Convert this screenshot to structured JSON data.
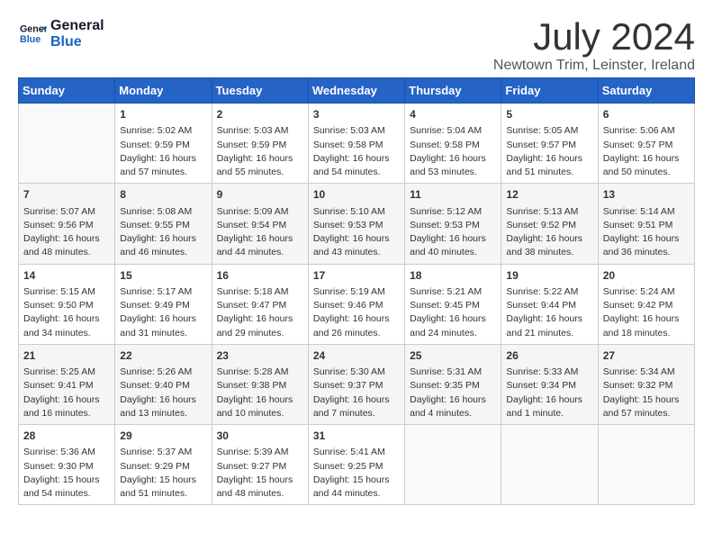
{
  "header": {
    "logo_line1": "General",
    "logo_line2": "Blue",
    "month_year": "July 2024",
    "location": "Newtown Trim, Leinster, Ireland"
  },
  "weekdays": [
    "Sunday",
    "Monday",
    "Tuesday",
    "Wednesday",
    "Thursday",
    "Friday",
    "Saturday"
  ],
  "weeks": [
    [
      {
        "day": "",
        "content": ""
      },
      {
        "day": "1",
        "content": "Sunrise: 5:02 AM\nSunset: 9:59 PM\nDaylight: 16 hours\nand 57 minutes."
      },
      {
        "day": "2",
        "content": "Sunrise: 5:03 AM\nSunset: 9:59 PM\nDaylight: 16 hours\nand 55 minutes."
      },
      {
        "day": "3",
        "content": "Sunrise: 5:03 AM\nSunset: 9:58 PM\nDaylight: 16 hours\nand 54 minutes."
      },
      {
        "day": "4",
        "content": "Sunrise: 5:04 AM\nSunset: 9:58 PM\nDaylight: 16 hours\nand 53 minutes."
      },
      {
        "day": "5",
        "content": "Sunrise: 5:05 AM\nSunset: 9:57 PM\nDaylight: 16 hours\nand 51 minutes."
      },
      {
        "day": "6",
        "content": "Sunrise: 5:06 AM\nSunset: 9:57 PM\nDaylight: 16 hours\nand 50 minutes."
      }
    ],
    [
      {
        "day": "7",
        "content": "Sunrise: 5:07 AM\nSunset: 9:56 PM\nDaylight: 16 hours\nand 48 minutes."
      },
      {
        "day": "8",
        "content": "Sunrise: 5:08 AM\nSunset: 9:55 PM\nDaylight: 16 hours\nand 46 minutes."
      },
      {
        "day": "9",
        "content": "Sunrise: 5:09 AM\nSunset: 9:54 PM\nDaylight: 16 hours\nand 44 minutes."
      },
      {
        "day": "10",
        "content": "Sunrise: 5:10 AM\nSunset: 9:53 PM\nDaylight: 16 hours\nand 43 minutes."
      },
      {
        "day": "11",
        "content": "Sunrise: 5:12 AM\nSunset: 9:53 PM\nDaylight: 16 hours\nand 40 minutes."
      },
      {
        "day": "12",
        "content": "Sunrise: 5:13 AM\nSunset: 9:52 PM\nDaylight: 16 hours\nand 38 minutes."
      },
      {
        "day": "13",
        "content": "Sunrise: 5:14 AM\nSunset: 9:51 PM\nDaylight: 16 hours\nand 36 minutes."
      }
    ],
    [
      {
        "day": "14",
        "content": "Sunrise: 5:15 AM\nSunset: 9:50 PM\nDaylight: 16 hours\nand 34 minutes."
      },
      {
        "day": "15",
        "content": "Sunrise: 5:17 AM\nSunset: 9:49 PM\nDaylight: 16 hours\nand 31 minutes."
      },
      {
        "day": "16",
        "content": "Sunrise: 5:18 AM\nSunset: 9:47 PM\nDaylight: 16 hours\nand 29 minutes."
      },
      {
        "day": "17",
        "content": "Sunrise: 5:19 AM\nSunset: 9:46 PM\nDaylight: 16 hours\nand 26 minutes."
      },
      {
        "day": "18",
        "content": "Sunrise: 5:21 AM\nSunset: 9:45 PM\nDaylight: 16 hours\nand 24 minutes."
      },
      {
        "day": "19",
        "content": "Sunrise: 5:22 AM\nSunset: 9:44 PM\nDaylight: 16 hours\nand 21 minutes."
      },
      {
        "day": "20",
        "content": "Sunrise: 5:24 AM\nSunset: 9:42 PM\nDaylight: 16 hours\nand 18 minutes."
      }
    ],
    [
      {
        "day": "21",
        "content": "Sunrise: 5:25 AM\nSunset: 9:41 PM\nDaylight: 16 hours\nand 16 minutes."
      },
      {
        "day": "22",
        "content": "Sunrise: 5:26 AM\nSunset: 9:40 PM\nDaylight: 16 hours\nand 13 minutes."
      },
      {
        "day": "23",
        "content": "Sunrise: 5:28 AM\nSunset: 9:38 PM\nDaylight: 16 hours\nand 10 minutes."
      },
      {
        "day": "24",
        "content": "Sunrise: 5:30 AM\nSunset: 9:37 PM\nDaylight: 16 hours\nand 7 minutes."
      },
      {
        "day": "25",
        "content": "Sunrise: 5:31 AM\nSunset: 9:35 PM\nDaylight: 16 hours\nand 4 minutes."
      },
      {
        "day": "26",
        "content": "Sunrise: 5:33 AM\nSunset: 9:34 PM\nDaylight: 16 hours\nand 1 minute."
      },
      {
        "day": "27",
        "content": "Sunrise: 5:34 AM\nSunset: 9:32 PM\nDaylight: 15 hours\nand 57 minutes."
      }
    ],
    [
      {
        "day": "28",
        "content": "Sunrise: 5:36 AM\nSunset: 9:30 PM\nDaylight: 15 hours\nand 54 minutes."
      },
      {
        "day": "29",
        "content": "Sunrise: 5:37 AM\nSunset: 9:29 PM\nDaylight: 15 hours\nand 51 minutes."
      },
      {
        "day": "30",
        "content": "Sunrise: 5:39 AM\nSunset: 9:27 PM\nDaylight: 15 hours\nand 48 minutes."
      },
      {
        "day": "31",
        "content": "Sunrise: 5:41 AM\nSunset: 9:25 PM\nDaylight: 15 hours\nand 44 minutes."
      },
      {
        "day": "",
        "content": ""
      },
      {
        "day": "",
        "content": ""
      },
      {
        "day": "",
        "content": ""
      }
    ]
  ]
}
